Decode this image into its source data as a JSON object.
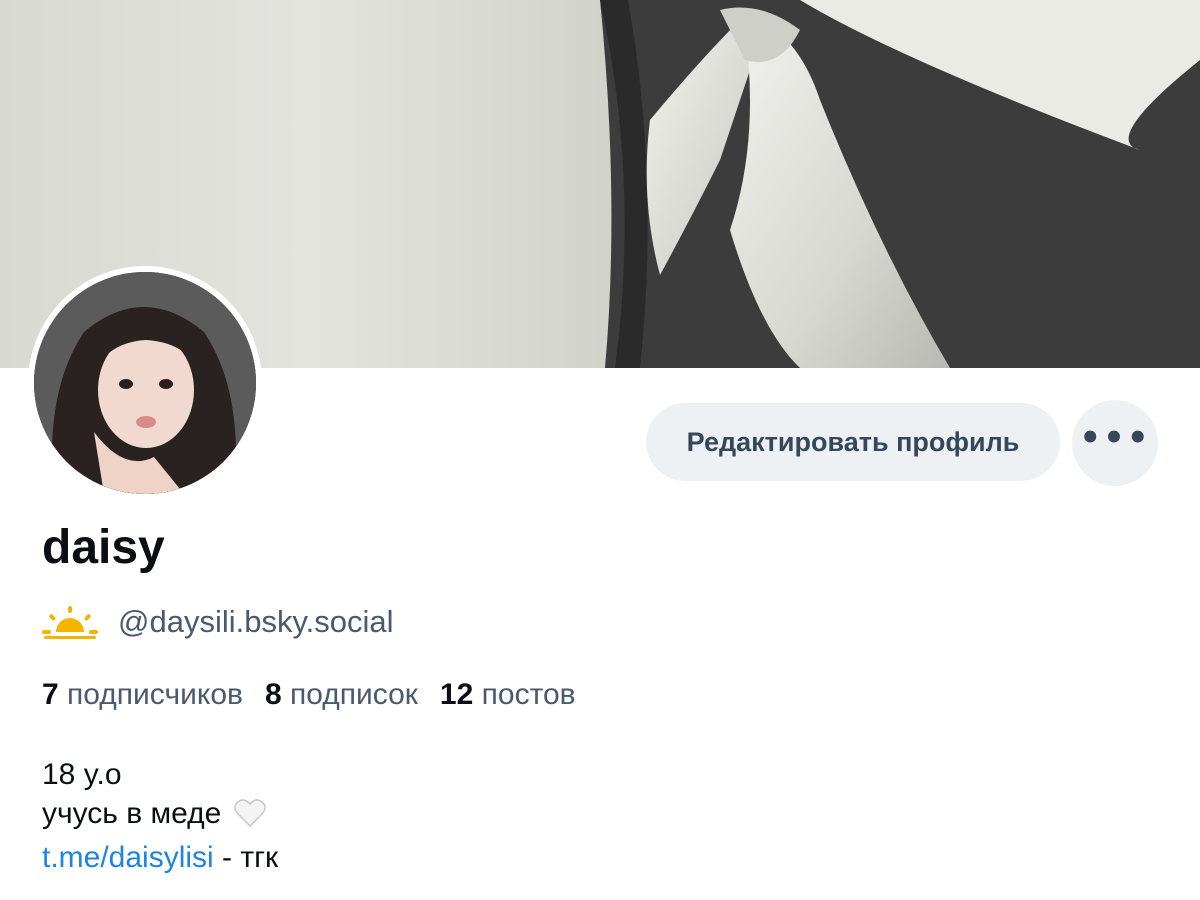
{
  "profile": {
    "display_name": "daisy",
    "handle": "@daysili.bsky.social",
    "handle_icon": "sunrise-icon",
    "accent_link_color": "#1d83e6"
  },
  "actions": {
    "edit_profile_label": "Редактировать профиль",
    "more_label": "•••"
  },
  "stats": [
    {
      "count": "7",
      "label": "подписчиков"
    },
    {
      "count": "8",
      "label": "подписок"
    },
    {
      "count": "12",
      "label": "постов"
    }
  ],
  "bio": {
    "line1": "18 y.o",
    "line2": "учусь в меде",
    "line2_icon": "white-heart-icon",
    "link_text": "t.me/daisylisi",
    "link_suffix": " - тгк"
  }
}
